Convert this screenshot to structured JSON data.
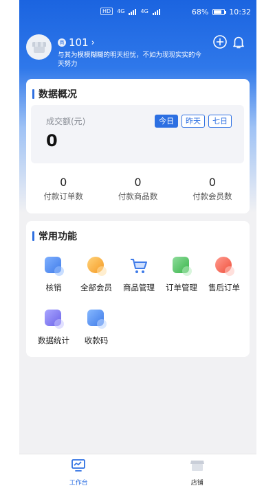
{
  "status_bar": {
    "battery": "68%",
    "time": "10:32",
    "net_left": "4G",
    "net_right": "4G"
  },
  "profile": {
    "badge": "商",
    "shop_name": "101",
    "motto": "与其为模模糊糊的明天担忧，不如为现现实实的今天努力"
  },
  "overview": {
    "title": "数据概况",
    "sales_label": "成交额(元)",
    "sales_value": "0",
    "ranges": [
      "今日",
      "昨天",
      "七日"
    ],
    "active_range": "今日",
    "stats": [
      {
        "value": "0",
        "label": "付款订单数"
      },
      {
        "value": "0",
        "label": "付款商品数"
      },
      {
        "value": "0",
        "label": "付款会员数"
      }
    ]
  },
  "functions": {
    "title": "常用功能",
    "items": [
      {
        "label": "核销",
        "icon": "verify-icon"
      },
      {
        "label": "全部会员",
        "icon": "members-icon"
      },
      {
        "label": "商品管理",
        "icon": "cart-icon"
      },
      {
        "label": "订单管理",
        "icon": "order-icon"
      },
      {
        "label": "售后订单",
        "icon": "aftersale-icon"
      },
      {
        "label": "数据统计",
        "icon": "stats-icon"
      },
      {
        "label": "收款码",
        "icon": "qrcode-icon"
      }
    ]
  },
  "tabbar": {
    "items": [
      {
        "label": "工作台",
        "icon": "monitor-icon"
      },
      {
        "label": "店铺",
        "icon": "store-icon"
      }
    ],
    "active": "工作台"
  },
  "colors": {
    "primary": "#2c6fe2",
    "header_gradient_top": "#1b64e0",
    "background": "#f1f1f3"
  }
}
